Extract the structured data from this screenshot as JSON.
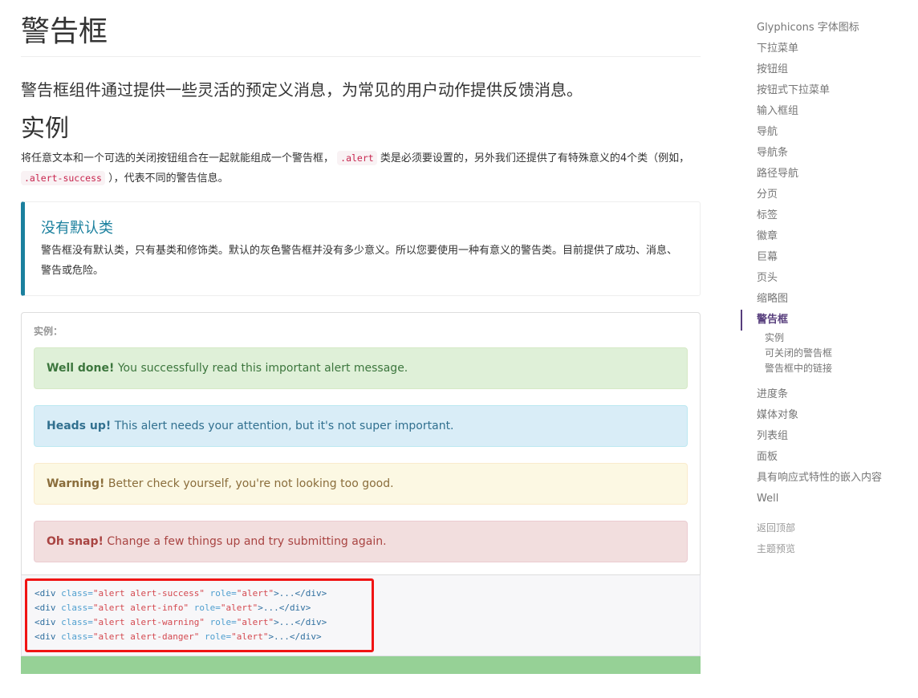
{
  "title": "警告框",
  "lead": "警告框组件通过提供一些灵活的预定义消息，为常见的用户动作提供反馈消息。",
  "section_title": "实例",
  "desc": {
    "p1": "将任意文本和一个可选的关闭按钮组合在一起就能组成一个警告框，",
    "code1": ".alert",
    "p2": "类是必须要设置的，另外我们还提供了有特殊意义的4个类（例如，",
    "code2": ".alert-success",
    "p3": "），代表不同的警告信息。"
  },
  "callout": {
    "title": "没有默认类",
    "text": "警告框没有默认类，只有基类和修饰类。默认的灰色警告框并没有多少意义。所以您要使用一种有意义的警告类。目前提供了成功、消息、警告或危险。"
  },
  "example": {
    "label": "实例：",
    "alerts": [
      {
        "strong": "Well done!",
        "text": " You successfully read this important alert message."
      },
      {
        "strong": "Heads up!",
        "text": " This alert needs your attention, but it's not super important."
      },
      {
        "strong": "Warning!",
        "text": " Better check yourself, you're not looking too good."
      },
      {
        "strong": "Oh snap!",
        "text": " Change a few things up and try submitting again."
      }
    ]
  },
  "code_lines": [
    {
      "open": "<div ",
      "cls": "class=",
      "val": "\"alert alert-success\"",
      "role": " role=",
      "rval": "\"alert\"",
      "end": ">...</div>"
    },
    {
      "open": "<div ",
      "cls": "class=",
      "val": "\"alert alert-info\"",
      "role": " role=",
      "rval": "\"alert\"",
      "end": ">...</div>"
    },
    {
      "open": "<div ",
      "cls": "class=",
      "val": "\"alert alert-warning\"",
      "role": " role=",
      "rval": "\"alert\"",
      "end": ">...</div>"
    },
    {
      "open": "<div ",
      "cls": "class=",
      "val": "\"alert alert-danger\"",
      "role": " role=",
      "rval": "\"alert\"",
      "end": ">...</div>"
    }
  ],
  "sidebar": {
    "items": [
      "Glyphicons 字体图标",
      "下拉菜单",
      "按钮组",
      "按钮式下拉菜单",
      "输入框组",
      "导航",
      "导航条",
      "路径导航",
      "分页",
      "标签",
      "徽章",
      "巨幕",
      "页头",
      "缩略图",
      "警告框"
    ],
    "sub": [
      "实例",
      "可关闭的警告框",
      "警告框中的链接"
    ],
    "items2": [
      "进度条",
      "媒体对象",
      "列表组",
      "面板",
      "具有响应式特性的嵌入内容",
      "Well"
    ],
    "bottom": [
      "返回顶部",
      "主题预览"
    ]
  }
}
